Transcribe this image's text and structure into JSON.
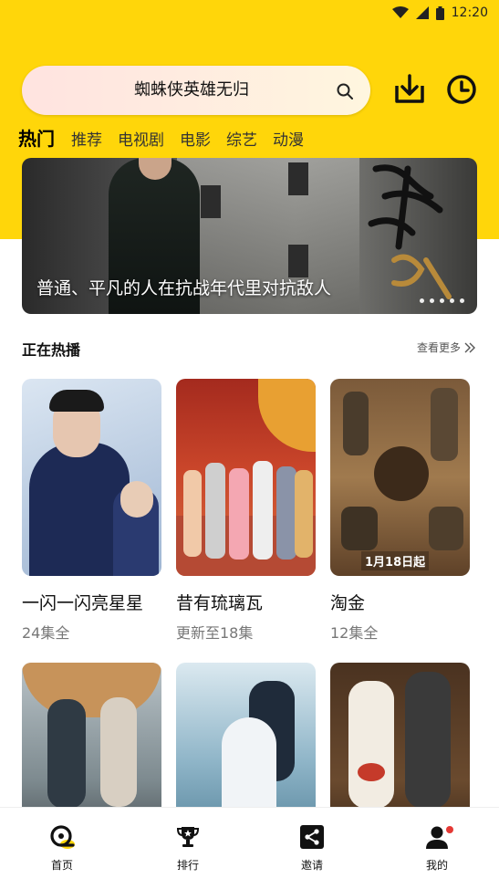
{
  "status_bar": {
    "time": "12:20"
  },
  "search": {
    "text": "蜘蛛侠英雄无归"
  },
  "tabs": [
    {
      "label": "热门",
      "active": true
    },
    {
      "label": "推荐"
    },
    {
      "label": "电视剧"
    },
    {
      "label": "电影"
    },
    {
      "label": "综艺"
    },
    {
      "label": "动漫"
    }
  ],
  "banner": {
    "title": "普通、平凡的人在抗战年代里对抗敌人"
  },
  "section": {
    "title": "正在热播",
    "more": "查看更多"
  },
  "cards": [
    {
      "title": "一闪一闪亮星星",
      "subtitle": "24集全"
    },
    {
      "title": "昔有琉璃瓦",
      "subtitle": "更新至18集"
    },
    {
      "title": "淘金",
      "subtitle": "12集全",
      "badge": "1月18日起"
    },
    {
      "title": "",
      "subtitle": ""
    },
    {
      "title": "",
      "subtitle": ""
    },
    {
      "title": "",
      "subtitle": ""
    }
  ],
  "bottom_nav": [
    {
      "label": "首页",
      "icon": "home-icon"
    },
    {
      "label": "排行",
      "icon": "trophy-icon"
    },
    {
      "label": "邀请",
      "icon": "share-icon"
    },
    {
      "label": "我的",
      "icon": "user-icon"
    }
  ],
  "colors": {
    "accent": "#FFD60A",
    "badge": "#e53935"
  }
}
